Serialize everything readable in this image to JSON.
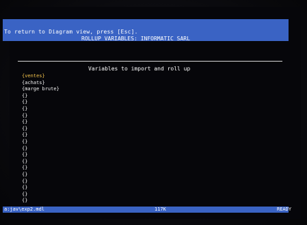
{
  "header": {
    "hint": "To return to Diagram view, press [Esc].",
    "title": "ROLLUP VARIABLES: INFORMATIC SARL"
  },
  "main": {
    "section_title": "Variables to import and roll up",
    "variables": [
      {
        "label": "{ventes}",
        "selected": true
      },
      {
        "label": "{achats}",
        "selected": false
      },
      {
        "label": "{marge brute}",
        "selected": false
      },
      {
        "label": "{}",
        "selected": false
      },
      {
        "label": "{}",
        "selected": false
      },
      {
        "label": "{}",
        "selected": false
      },
      {
        "label": "{}",
        "selected": false
      },
      {
        "label": "{}",
        "selected": false
      },
      {
        "label": "{}",
        "selected": false
      },
      {
        "label": "{}",
        "selected": false
      },
      {
        "label": "{}",
        "selected": false
      },
      {
        "label": "{}",
        "selected": false
      },
      {
        "label": "{}",
        "selected": false
      },
      {
        "label": "{}",
        "selected": false
      },
      {
        "label": "{}",
        "selected": false
      },
      {
        "label": "{}",
        "selected": false
      },
      {
        "label": "{}",
        "selected": false
      },
      {
        "label": "{}",
        "selected": false
      },
      {
        "label": "{}",
        "selected": false
      },
      {
        "label": "{}",
        "selected": false
      }
    ]
  },
  "status": {
    "path": "a:jav\\exp2.mdl",
    "memory": "117K",
    "mode": "READY"
  },
  "colors": {
    "highlight_bar": "#3a63c4",
    "selected_text": "#f2c14a",
    "text": "#f2f2f2",
    "background": "#06060a"
  }
}
